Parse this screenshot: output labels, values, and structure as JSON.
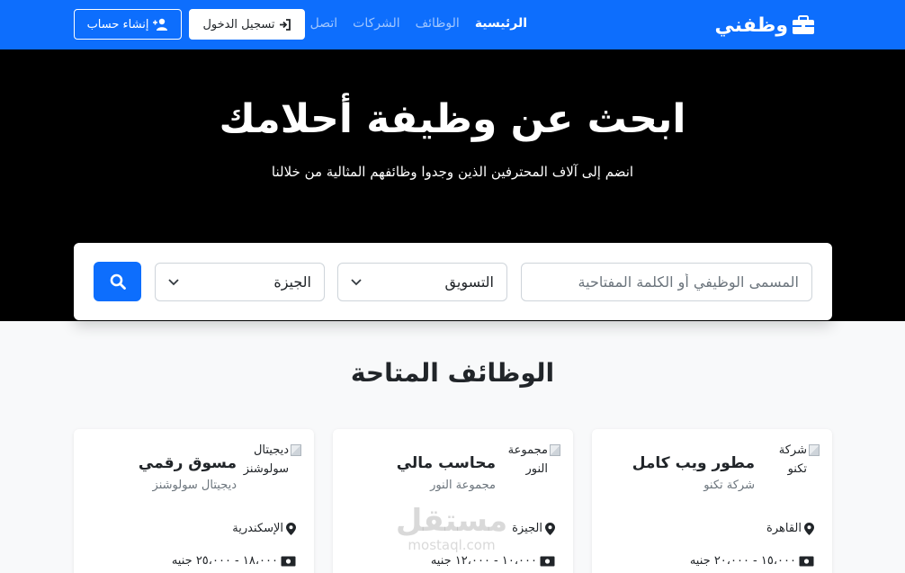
{
  "navbar": {
    "brand": "وظفني",
    "links": [
      {
        "label": "الرئيسية",
        "active": true
      },
      {
        "label": "الوظائف",
        "active": false
      },
      {
        "label": "الشركات",
        "active": false
      },
      {
        "label": "اتصل بنا",
        "active": false
      }
    ],
    "login_label": "تسجيل الدخول",
    "signup_label": "إنشاء حساب"
  },
  "hero": {
    "title": "ابحث عن وظيفة أحلامك",
    "subtitle": "انضم إلى آلاف المحترفين الذين وجدوا وظائفهم المثالية من خلالنا"
  },
  "search": {
    "placeholder": "المسمى الوظيفي أو الكلمة المفتاحية",
    "category_selected": "التسويق",
    "city_selected": "الجيزة"
  },
  "jobs_section": {
    "title": "الوظائف المتاحة"
  },
  "jobs": [
    {
      "logo_alt": "شركة تكنو",
      "title": "مطور ويب كامل",
      "company": "شركة تكنو",
      "location": "القاهرة",
      "salary": "١٥،٠٠٠ - ٢٠،٠٠٠ جنيه"
    },
    {
      "logo_alt": "مجموعة النور",
      "title": "محاسب مالي",
      "company": "مجموعة النور",
      "location": "الجيزة",
      "salary": "١٠،٠٠٠ - ١٢،٠٠٠ جنيه"
    },
    {
      "logo_alt": "ديجيتال سولوشنز",
      "title": "مسوق رقمي",
      "company": "ديجيتال سولوشنز",
      "location": "الإسكندرية",
      "salary": "١٨،٠٠٠ - ٢٥،٠٠٠ جنيه"
    }
  ],
  "watermark": {
    "main": "مستقل",
    "sub": "mostaql.com"
  },
  "colors": {
    "primary": "#0d6efd",
    "hero_bg": "#000000",
    "page_bg": "#f8f9fa"
  }
}
